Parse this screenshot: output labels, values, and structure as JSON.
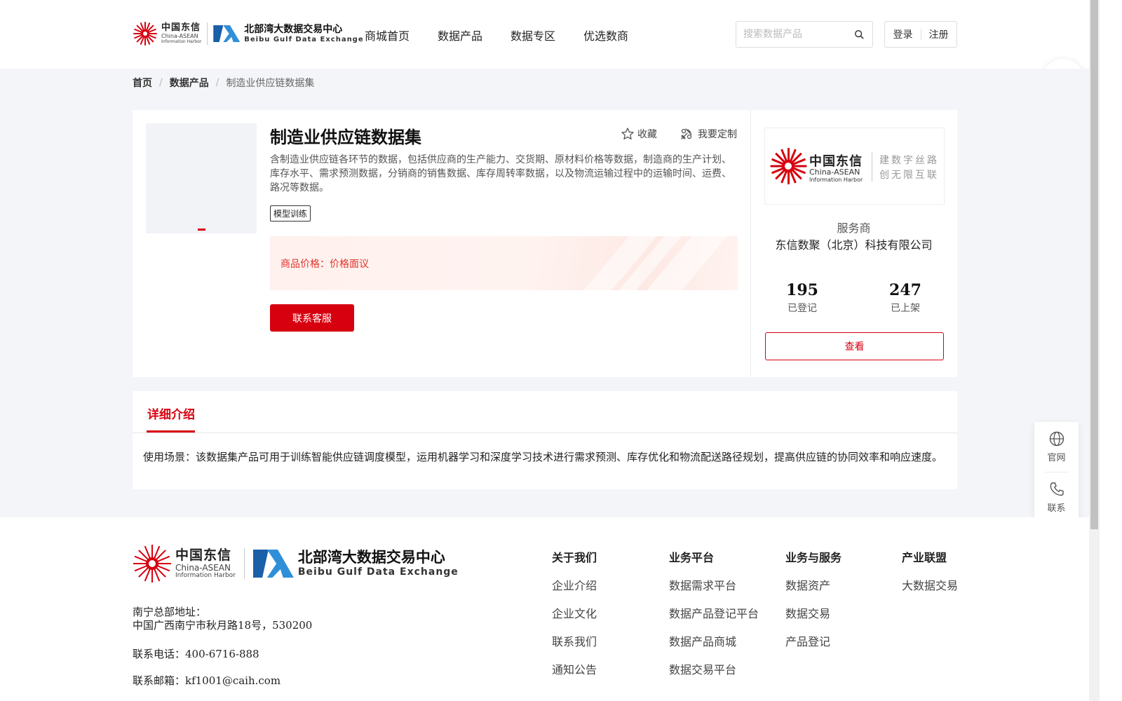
{
  "header": {
    "logo_cn": "中国东信",
    "logo_en": "China-ASEAN",
    "logo_en2": "Information Harbor",
    "exchange_cn": "北部湾大数据交易中心",
    "exchange_en": "Beibu Gulf Data Exchange",
    "nav": [
      "商城首页",
      "数据产品",
      "数据专区",
      "优选数商"
    ],
    "search_placeholder": "搜索数据产品",
    "login": "登录",
    "register": "注册"
  },
  "breadcrumb": {
    "home": "首页",
    "category": "数据产品",
    "current": "制造业供应链数据集",
    "separator": "/"
  },
  "product": {
    "title": "制造业供应链数据集",
    "favorite": "收藏",
    "customize": "我要定制",
    "description": "含制造业供应链各环节的数据，包括供应商的生产能力、交货期、原材料价格等数据，制造商的生产计划、库存水平、需求预测数据，分销商的销售数据、库存周转率数据，以及物流运输过程中的运输时间、运费、路况等数据。",
    "tag": "模型训练",
    "price_label": "商品价格：",
    "price_value": "价格面议",
    "contact_button": "联系客服"
  },
  "provider": {
    "logo_cn": "中国东信",
    "logo_en": "China-ASEAN",
    "logo_en2": "Information Harbor",
    "slogan_line1": "建数字丝路",
    "slogan_line2": "创无限互联",
    "label": "服务商",
    "name": "东信数聚（北京）科技有限公司",
    "registered_count": "195",
    "registered_label": "已登记",
    "listed_count": "247",
    "listed_label": "已上架",
    "view_button": "查看"
  },
  "detail": {
    "tab": "详细介绍",
    "text": "使用场景：该数据集产品可用于训练智能供应链调度模型，运用机器学习和深度学习技术进行需求预测、库存优化和物流配送路径规划，提高供应链的协同效率和响应速度。"
  },
  "float_panel": {
    "website": "官网",
    "contact": "联系"
  },
  "footer": {
    "logo_cn": "中国东信",
    "logo_en": "China-ASEAN",
    "logo_en2": "Information Harbor",
    "exchange_cn": "北部湾大数据交易中心",
    "exchange_en": "Beibu Gulf Data Exchange",
    "address_label": "南宁总部地址：",
    "address": "中国广西南宁市秋月路18号，530200",
    "phone": "联系电话：400-6716-888",
    "email": "联系邮箱：kf1001@caih.com",
    "columns": [
      {
        "title": "关于我们",
        "links": [
          "企业介绍",
          "企业文化",
          "联系我们",
          "通知公告"
        ]
      },
      {
        "title": "业务平台",
        "links": [
          "数据需求平台",
          "数据产品登记平台",
          "数据产品商城",
          "数据交易平台"
        ]
      },
      {
        "title": "业务与服务",
        "links": [
          "数据资产",
          "数据交易",
          "产品登记"
        ]
      },
      {
        "title": "产业联盟",
        "links": [
          "大数据交易"
        ]
      }
    ]
  },
  "colors": {
    "brand_red": "#d7000f",
    "price_red": "#e2322b",
    "page_bg": "#f4f5f8"
  }
}
